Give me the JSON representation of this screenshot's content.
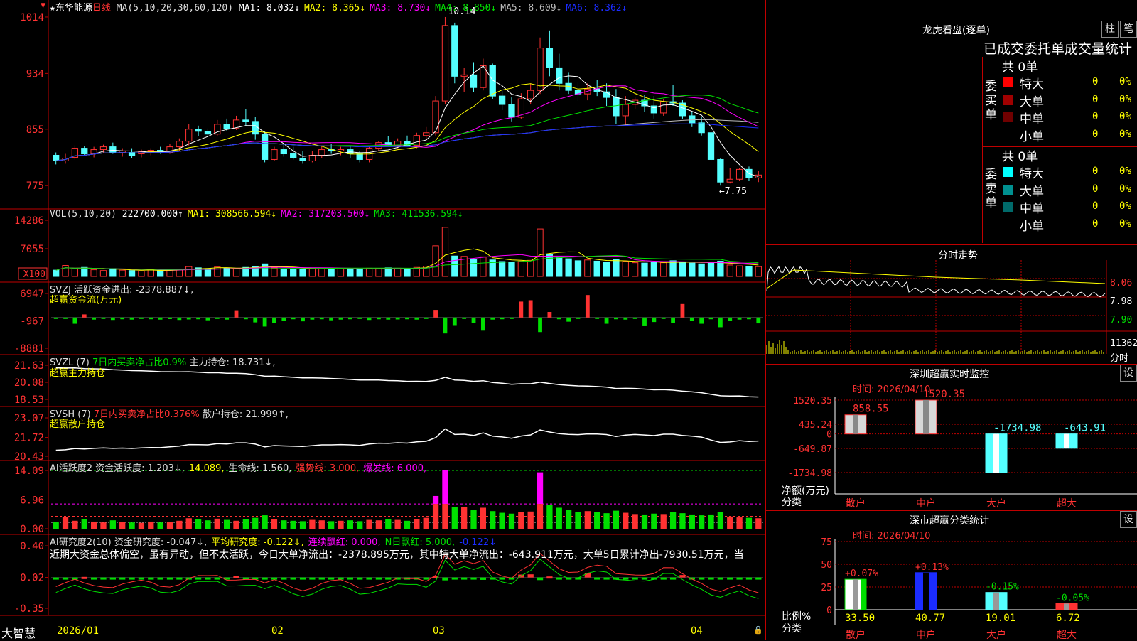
{
  "stock": {
    "star": "★",
    "name": "东华能源",
    "period": "日线"
  },
  "colors": {
    "up": "#ff3232",
    "down": "#54ffff",
    "frame": "#c00000",
    "white": "#ffffff",
    "yellow": "#ffff00",
    "magenta": "#ff00ff",
    "green": "#00e000",
    "blue": "#1b2cff",
    "gray": "#bbbbbb"
  },
  "panels": {
    "main": {
      "indicator": "MA(5,10,20,30,60,120)",
      "items": [
        {
          "label": "MA1:",
          "value": "8.032↓",
          "color": "#ffffff"
        },
        {
          "label": "MA2:",
          "value": "8.365↓",
          "color": "#ffff00"
        },
        {
          "label": "MA3:",
          "value": "8.730↓",
          "color": "#ff00ff"
        },
        {
          "label": "MA4:",
          "value": "8.850↓",
          "color": "#00e000"
        },
        {
          "label": "MA5:",
          "value": "8.609↓",
          "color": "#bbbbbb"
        },
        {
          "label": "MA6:",
          "value": "8.362↓",
          "color": "#1b2cff"
        }
      ],
      "yticks": [
        "1014",
        "934",
        "855",
        "775"
      ],
      "high_label": "10.14",
      "low_label": "←7.75"
    },
    "vol": {
      "indicator": "VOL(5,10,20)",
      "items": [
        {
          "label": "",
          "value": "222700.000↑",
          "color": "#ffffff"
        },
        {
          "label": "MA1:",
          "value": "308566.594↓",
          "color": "#ffff00"
        },
        {
          "label": "MA2:",
          "value": "317203.500↓",
          "color": "#ff00ff"
        },
        {
          "label": "MA3:",
          "value": "411536.594↓",
          "color": "#00e000"
        }
      ],
      "yticks": [
        "14286",
        "7055"
      ],
      "unit": "X100"
    },
    "svzj": {
      "title": "SVZJ  活跃资金进出: -2378.887↓,",
      "subtitle": "超赢资金流(万元)",
      "yticks": [
        "6947",
        "-967",
        "-8881"
      ]
    },
    "svzl": {
      "prefix": "SVZL (7)",
      "green_text": "7日内买卖净占比0.9%",
      "suffix": "主力持仓: 18.731↓,",
      "subtitle": "超赢主力持仓",
      "yticks": [
        "21.63",
        "20.08",
        "18.53"
      ]
    },
    "svsh": {
      "prefix": "SVSH (7)",
      "red_text": "7日内买卖净占比0.376%",
      "suffix": "散户持仓: 21.999↑,",
      "subtitle": "超赢散户持仓",
      "yticks": [
        "23.07",
        "21.72",
        "20.43"
      ]
    },
    "ai1": {
      "items": [
        {
          "text": "AI活跃度2 资金活跃度: 1.203↓,",
          "color": "#dddddd"
        },
        {
          "text": "14.089,",
          "color": "#ffff00"
        },
        {
          "text": "生命线: 1.560,",
          "color": "#dddddd"
        },
        {
          "text": "强势线: 3.000,",
          "color": "#ff3232"
        },
        {
          "text": "爆发线: 6.000,",
          "color": "#ff00ff"
        }
      ],
      "yticks": [
        "14.09",
        "6.96",
        "0.00"
      ]
    },
    "ai2": {
      "items": [
        {
          "text": "AI研究度2(10) 资金研究度: -0.047↓,",
          "color": "#dddddd"
        },
        {
          "text": "平均研究度: -0.122↓,",
          "color": "#ffff00"
        },
        {
          "text": "连续飘红: 0.000,",
          "color": "#ff00ff"
        },
        {
          "text": "N日飘红: 5.000,",
          "color": "#00e000"
        },
        {
          "text": "-0.122↓",
          "color": "#1b2cff"
        }
      ],
      "comment": "近期大资金总体偏空，虽有异动，但不太活跃，今日大单净流出：-2378.895万元，其中特大单净流出：-643.911万元，大单5日累计净出-7930.51万元，当",
      "yticks": [
        "0.40",
        "0.02",
        "-0.35"
      ]
    }
  },
  "xaxis": {
    "logo": "大智慧",
    "labels": [
      "2026/01",
      "02",
      "03",
      "04"
    ]
  },
  "right": {
    "lhb": {
      "title": "龙虎看盘(逐单)",
      "btn1": "柱",
      "btn2": "笔",
      "subtitle": "已成交委托单成交量统计",
      "buy": {
        "side": "委买单",
        "total": "共 0单",
        "rows": [
          {
            "name": "特大",
            "count": "0",
            "pct": "0%",
            "color": "#ff0000"
          },
          {
            "name": "大单",
            "count": "0",
            "pct": "0%",
            "color": "#a00000"
          },
          {
            "name": "中单",
            "count": "0",
            "pct": "0%",
            "color": "#700000"
          },
          {
            "name": "小单",
            "count": "0",
            "pct": "0%",
            "color": ""
          }
        ]
      },
      "sell": {
        "side": "委卖单",
        "total": "共 0单",
        "rows": [
          {
            "name": "特大",
            "count": "0",
            "pct": "0%",
            "color": "#00ffff"
          },
          {
            "name": "大单",
            "count": "0",
            "pct": "0%",
            "color": "#009090"
          },
          {
            "name": "中单",
            "count": "0",
            "pct": "0%",
            "color": "#006a6a"
          },
          {
            "name": "小单",
            "count": "0",
            "pct": "0%",
            "color": ""
          }
        ]
      }
    },
    "intraday": {
      "title": "分时走势",
      "yticks": [
        "8.06",
        "7.98",
        "7.90"
      ],
      "vol_label": "11362",
      "vol_unit": "分时"
    },
    "monitor": {
      "title": "深圳超赢实时监控",
      "btn": "设",
      "time": "时间: 2026/04/10",
      "yticks": [
        "1520.35",
        "435.24",
        "0",
        "-649.87",
        "-1734.98"
      ],
      "ylabel": "净额(万元)",
      "xlabel": "分类",
      "bars": [
        {
          "cat": "散户",
          "value": 858.55,
          "label": "858.55"
        },
        {
          "cat": "中户",
          "value": 1520.35,
          "label": "1520.35"
        },
        {
          "cat": "大户",
          "value": -1734.98,
          "label": "-1734.98"
        },
        {
          "cat": "超大",
          "value": -643.91,
          "label": "-643.91"
        }
      ]
    },
    "stats": {
      "title": "深市超赢分类统计",
      "btn": "设",
      "time": "时间: 2026/04/10",
      "yticks": [
        "75",
        "50",
        "25",
        "0"
      ],
      "ylabel": "比例%",
      "xlabel": "分类",
      "bars": [
        {
          "cat": "散户",
          "value": 33.5,
          "label": "33.50",
          "change": "+0.07%",
          "change_color": "#ff3232",
          "color": "#ffffff",
          "edge": "#00e000"
        },
        {
          "cat": "中户",
          "value": 40.77,
          "label": "40.77",
          "change": "+0.13%",
          "change_color": "#ff3232",
          "color": "#1b2cff",
          "edge": "#1b2cff"
        },
        {
          "cat": "大户",
          "value": 19.01,
          "label": "19.01",
          "change": "-0.15%",
          "change_color": "#00e000",
          "color": "#54ffff",
          "edge": "#54ffff"
        },
        {
          "cat": "超大",
          "value": 6.72,
          "label": "6.72",
          "change": "-0.05%",
          "change_color": "#00e000",
          "color": "#ff3232",
          "edge": "#ff3232"
        }
      ]
    }
  },
  "chart_data": {
    "type": "candlestick",
    "title": "东华能源 日线",
    "ylim": [
      7.5,
      10.2
    ],
    "x_labels": [
      "2026/01",
      "02",
      "03",
      "04"
    ],
    "ohlc": [
      [
        8.18,
        8.22,
        8.05,
        8.1
      ],
      [
        8.1,
        8.2,
        8.06,
        8.14
      ],
      [
        8.15,
        8.32,
        8.12,
        8.28
      ],
      [
        8.28,
        8.31,
        8.17,
        8.2
      ],
      [
        8.2,
        8.3,
        8.15,
        8.26
      ],
      [
        8.26,
        8.33,
        8.22,
        8.3
      ],
      [
        8.3,
        8.36,
        8.2,
        8.22
      ],
      [
        8.22,
        8.28,
        8.16,
        8.24
      ],
      [
        8.22,
        8.28,
        8.14,
        8.18
      ],
      [
        8.2,
        8.26,
        8.15,
        8.23
      ],
      [
        8.23,
        8.28,
        8.18,
        8.25
      ],
      [
        8.25,
        8.3,
        8.2,
        8.22
      ],
      [
        8.22,
        8.34,
        8.2,
        8.3
      ],
      [
        8.3,
        8.42,
        8.24,
        8.38
      ],
      [
        8.38,
        8.62,
        8.32,
        8.55
      ],
      [
        8.55,
        8.6,
        8.45,
        8.52
      ],
      [
        8.52,
        8.56,
        8.44,
        8.48
      ],
      [
        8.48,
        8.68,
        8.46,
        8.62
      ],
      [
        8.62,
        8.7,
        8.52,
        8.56
      ],
      [
        8.56,
        8.74,
        8.54,
        8.68
      ],
      [
        8.68,
        8.84,
        8.6,
        8.66
      ],
      [
        8.66,
        8.72,
        8.4,
        8.48
      ],
      [
        8.48,
        8.52,
        8.08,
        8.12
      ],
      [
        8.12,
        8.3,
        8.1,
        8.26
      ],
      [
        8.26,
        8.34,
        8.16,
        8.2
      ],
      [
        8.2,
        8.3,
        8.12,
        8.14
      ],
      [
        8.14,
        8.24,
        8.06,
        8.1
      ],
      [
        8.1,
        8.24,
        8.08,
        8.18
      ],
      [
        8.18,
        8.32,
        8.14,
        8.26
      ],
      [
        8.26,
        8.34,
        8.2,
        8.24
      ],
      [
        8.24,
        8.3,
        8.18,
        8.26
      ],
      [
        8.26,
        8.32,
        8.14,
        8.2
      ],
      [
        8.2,
        8.24,
        8.08,
        8.12
      ],
      [
        8.12,
        8.3,
        8.08,
        8.28
      ],
      [
        8.28,
        8.38,
        8.24,
        8.36
      ],
      [
        8.36,
        8.45,
        8.3,
        8.32
      ],
      [
        8.32,
        8.42,
        8.28,
        8.38
      ],
      [
        8.38,
        8.46,
        8.3,
        8.32
      ],
      [
        8.32,
        8.5,
        8.28,
        8.46
      ],
      [
        8.46,
        8.58,
        8.4,
        8.5
      ],
      [
        8.5,
        9.02,
        8.46,
        8.95
      ],
      [
        8.95,
        10.14,
        8.9,
        10.02
      ],
      [
        10.02,
        10.06,
        9.2,
        9.3
      ],
      [
        9.3,
        9.42,
        9.08,
        9.32
      ],
      [
        9.32,
        9.5,
        9.08,
        9.14
      ],
      [
        9.14,
        9.55,
        9.1,
        9.45
      ],
      [
        9.45,
        9.48,
        8.98,
        9.02
      ],
      [
        9.02,
        9.1,
        8.82,
        8.9
      ],
      [
        8.9,
        9.0,
        8.66,
        8.72
      ],
      [
        8.72,
        9.06,
        8.7,
        8.98
      ],
      [
        8.98,
        9.2,
        8.9,
        9.1
      ],
      [
        9.1,
        9.85,
        9.05,
        9.7
      ],
      [
        9.7,
        9.95,
        9.3,
        9.42
      ],
      [
        9.42,
        9.62,
        9.1,
        9.2
      ],
      [
        9.2,
        9.35,
        9.05,
        9.1
      ],
      [
        9.1,
        9.22,
        8.95,
        9.05
      ],
      [
        9.05,
        9.2,
        8.96,
        9.12
      ],
      [
        9.12,
        9.25,
        9.02,
        9.08
      ],
      [
        9.08,
        9.2,
        8.88,
        9.0
      ],
      [
        9.0,
        9.12,
        8.62,
        8.74
      ],
      [
        8.74,
        9.02,
        8.6,
        8.9
      ],
      [
        8.9,
        9.0,
        8.84,
        8.96
      ],
      [
        8.96,
        9.04,
        8.8,
        8.88
      ],
      [
        8.88,
        9.02,
        8.7,
        8.78
      ],
      [
        8.78,
        8.98,
        8.74,
        8.94
      ],
      [
        8.94,
        9.18,
        8.88,
        8.92
      ],
      [
        8.92,
        8.96,
        8.7,
        8.74
      ],
      [
        8.74,
        8.8,
        8.58,
        8.64
      ],
      [
        8.64,
        8.72,
        8.46,
        8.5
      ],
      [
        8.5,
        8.6,
        8.1,
        8.12
      ],
      [
        8.12,
        8.14,
        7.75,
        7.8
      ],
      [
        7.8,
        8.0,
        7.78,
        7.84
      ],
      [
        7.84,
        8.0,
        7.82,
        7.98
      ],
      [
        7.98,
        8.02,
        7.82,
        7.86
      ],
      [
        7.86,
        7.96,
        7.8,
        7.9
      ]
    ],
    "volume": [
      1600,
      2800,
      1900,
      2300,
      1700,
      1500,
      2000,
      1600,
      1500,
      1400,
      1700,
      1500,
      1600,
      1900,
      2500,
      2200,
      2000,
      2400,
      2100,
      1900,
      2300,
      2600,
      3200,
      2200,
      2000,
      1900,
      1800,
      2100,
      2000,
      1800,
      1900,
      2000,
      1800,
      2100,
      2000,
      2200,
      2100,
      1900,
      2300,
      2600,
      7800,
      12500,
      5200,
      5100,
      4400,
      5000,
      4200,
      3800,
      3600,
      3900,
      4100,
      12100,
      5600,
      5000,
      4500,
      4000,
      4200,
      3900,
      3700,
      4300,
      3800,
      3500,
      3400,
      3600,
      3500,
      4000,
      3700,
      3400,
      3200,
      3400,
      3900,
      2900,
      2700,
      2600,
      2500
    ],
    "svzj": [
      -200,
      -400,
      -1800,
      900,
      -600,
      -350,
      -700,
      -500,
      -600,
      -400,
      -500,
      -600,
      -450,
      -700,
      -550,
      -500,
      -800,
      -400,
      -600,
      2100,
      -500,
      -1400,
      -2600,
      -1500,
      -900,
      -500,
      -1100,
      -600,
      -500,
      -800,
      -600,
      -500,
      -400,
      -700,
      -500,
      -600,
      -550,
      -500,
      -600,
      -400,
      2200,
      -4600,
      -2400,
      -400,
      -1600,
      -3800,
      -600,
      -500,
      -400,
      4600,
      5000,
      -4200,
      1600,
      -500,
      -1200,
      -400,
      6500,
      -300,
      -1800,
      -500,
      -600,
      -400,
      -2500,
      -1300,
      -400,
      -1500,
      3900,
      -900,
      -1800,
      -500,
      -2800,
      -1000,
      -600,
      -500,
      -1700
    ]
  }
}
